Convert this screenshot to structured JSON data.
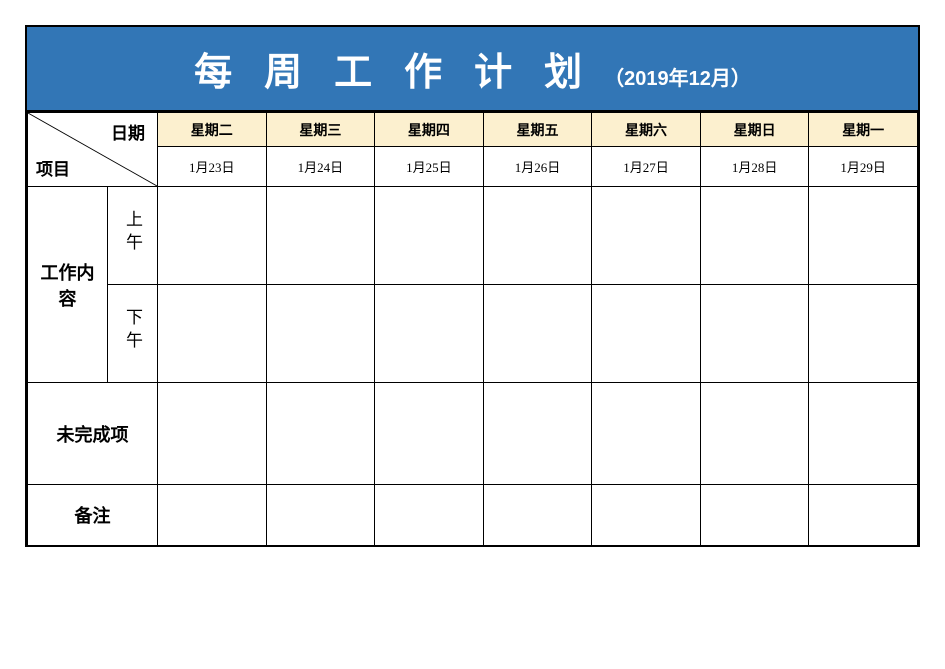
{
  "header": {
    "title_main": "每周工作计划",
    "title_sub": "（2019年12月）"
  },
  "corner": {
    "date_label": "日期",
    "project_label": "项目"
  },
  "weekdays": [
    "星期二",
    "星期三",
    "星期四",
    "星期五",
    "星期六",
    "星期日",
    "星期一"
  ],
  "dates": [
    "1月23日",
    "1月24日",
    "1月25日",
    "1月26日",
    "1月27日",
    "1月28日",
    "1月29日"
  ],
  "rows": {
    "work_content": "工作内容",
    "morning": "上午",
    "afternoon": "下午",
    "incomplete": "未完成项",
    "remark": "备注"
  },
  "cells": {
    "morning": [
      "",
      "",
      "",
      "",
      "",
      "",
      ""
    ],
    "afternoon": [
      "",
      "",
      "",
      "",
      "",
      "",
      ""
    ],
    "incomplete": [
      "",
      "",
      "",
      "",
      "",
      "",
      ""
    ]
  }
}
